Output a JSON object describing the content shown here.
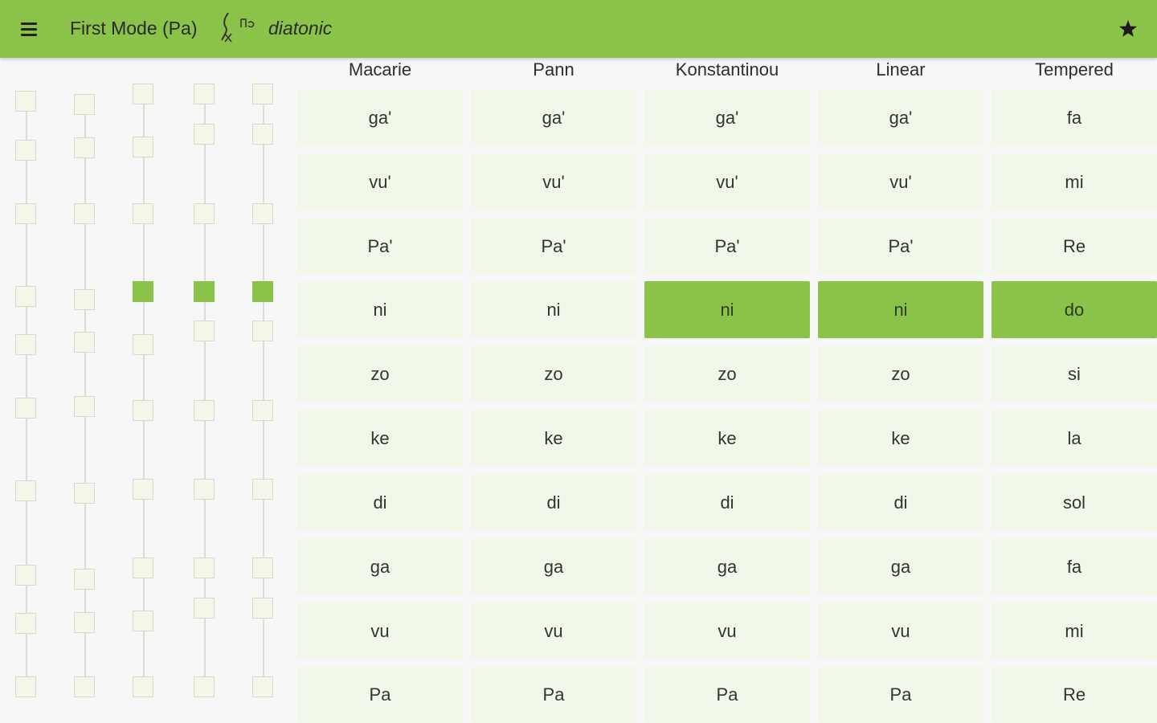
{
  "appbar": {
    "title": "First Mode (Pa)",
    "subtitle": "diatonic",
    "menu_icon": "menu-icon",
    "mode_icon": "martyria-icon",
    "star_icon": "star-icon"
  },
  "colors": {
    "accent": "#8bc34a",
    "cell": "#f1f8e9",
    "background": "#f7f7f7"
  },
  "columns": [
    "Macarie",
    "Pann",
    "Konstantinou",
    "Linear",
    "Tempered"
  ],
  "rows": [
    [
      "ga'",
      "ga'",
      "ga'",
      "ga'",
      "fa"
    ],
    [
      "vu'",
      "vu'",
      "vu'",
      "vu'",
      "mi"
    ],
    [
      "Pa'",
      "Pa'",
      "Pa'",
      "Pa'",
      "Re"
    ],
    [
      "ni",
      "ni",
      "ni",
      "ni",
      "do"
    ],
    [
      "zo",
      "zo",
      "zo",
      "zo",
      "si"
    ],
    [
      "ke",
      "ke",
      "ke",
      "ke",
      "la"
    ],
    [
      "di",
      "di",
      "di",
      "di",
      "sol"
    ],
    [
      "ga",
      "ga",
      "ga",
      "ga",
      "fa"
    ],
    [
      "vu",
      "vu",
      "vu",
      "vu",
      "mi"
    ],
    [
      "Pa",
      "Pa",
      "Pa",
      "Pa",
      "Re"
    ]
  ],
  "selected": {
    "row": 3,
    "columns": [
      "Konstantinou",
      "Linear",
      "Tempered"
    ]
  }
}
